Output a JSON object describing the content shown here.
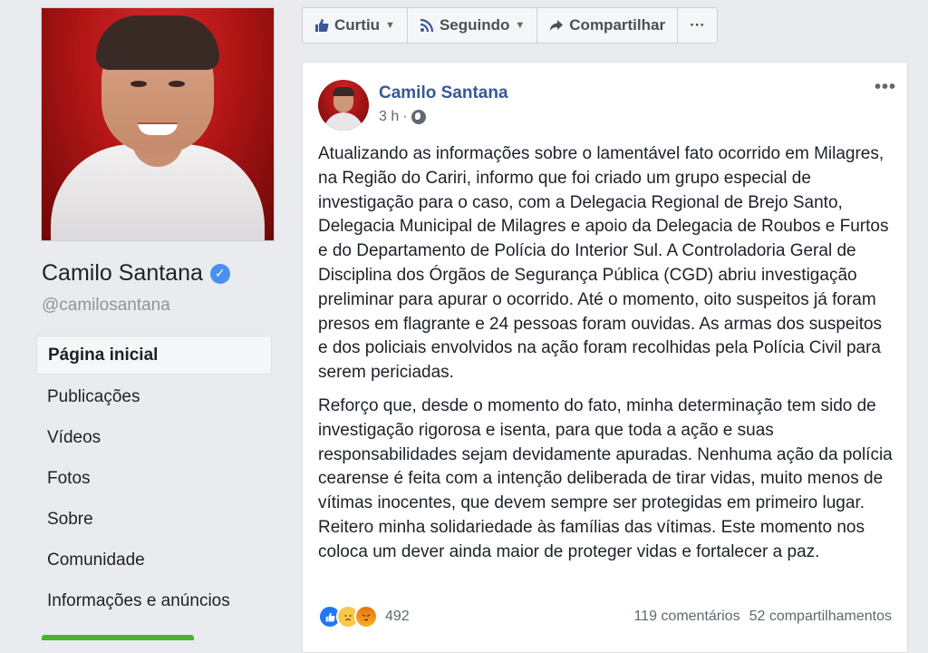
{
  "profile": {
    "name": "Camilo Santana",
    "handle": "@camilosantana",
    "verified_mark": "✓"
  },
  "nav": {
    "items": [
      {
        "label": "Página inicial",
        "active": true
      },
      {
        "label": "Publicações"
      },
      {
        "label": "Vídeos"
      },
      {
        "label": "Fotos"
      },
      {
        "label": "Sobre"
      },
      {
        "label": "Comunidade"
      },
      {
        "label": "Informações e anúncios"
      }
    ]
  },
  "actions": {
    "like_label": "Curtiu",
    "follow_label": "Seguindo",
    "share_label": "Compartilhar",
    "more_label": "···"
  },
  "post": {
    "author": "Camilo Santana",
    "time": "3 h",
    "separator": "·",
    "more_label": "•••",
    "paragraphs": [
      "Atualizando as informações sobre o lamentável fato ocorrido em Milagres, na Região do Cariri, informo que foi criado um grupo especial de investigação para o caso, com a Delegacia Regional de Brejo Santo, Delegacia Municipal de Milagres e apoio da Delegacia de Roubos e Furtos e do Departamento de Polícia do Interior Sul. A Controladoria Geral de Disciplina dos Órgãos de Segurança Pública (CGD) abriu investigação preliminar para apurar o ocorrido. Até o momento, oito suspeitos já foram presos em flagrante e 24 pessoas foram ouvidas. As armas dos suspeitos e dos policiais envolvidos na ação foram recolhidas pela Polícia Civil para serem periciadas.",
      "Reforço que, desde o momento do fato, minha determinação tem sido de investigação rigorosa e isenta, para que toda a ação e suas responsabilidades sejam devidamente apuradas. Nenhuma ação da polícia cearense é feita com a intenção deliberada de tirar vidas, muito menos de vítimas inocentes, que devem sempre ser protegidas em primeiro lugar. Reitero minha solidariedade às famílias das vítimas. Este momento nos coloca um dever ainda maior de proteger vidas e fortalecer a paz."
    ],
    "reaction_count": "492",
    "comments": "119 comentários",
    "shares": "52 compartilhamentos"
  },
  "colors": {
    "link": "#385898",
    "like": "#2078f4",
    "verified": "#4a90ef"
  }
}
